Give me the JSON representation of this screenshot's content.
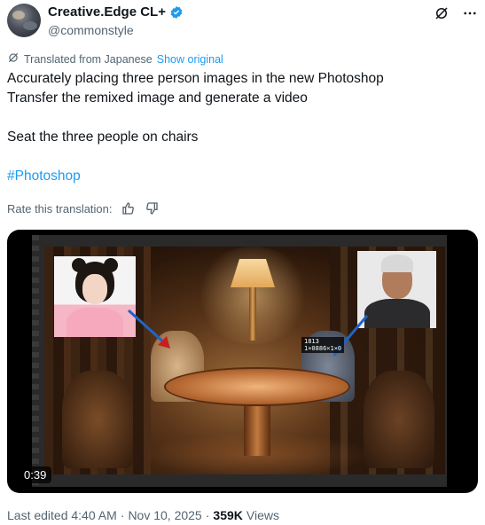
{
  "author": {
    "display_name": "Creative.Edge CL+",
    "handle": "@commonstyle",
    "verified_color": "#1d9bf0",
    "icons": [
      "grok-icon",
      "more-icon"
    ]
  },
  "translation": {
    "label": "Translated from Japanese",
    "show_original": "Show original"
  },
  "tweet": {
    "line1": "Accurately placing three person images in the new Photoshop",
    "line2": "Transfer the remixed image and generate a video",
    "line3": "Seat the three people on chairs",
    "hashtag": "#Photoshop"
  },
  "rate": {
    "label": "Rate this translation:"
  },
  "media": {
    "duration": "0:39",
    "tag_line1": "1813",
    "tag_line2": "1×0886×1×0"
  },
  "meta": {
    "edited": "Last edited 4:40 AM",
    "separator": "·",
    "date": "Nov 10, 2025",
    "separator2": "·",
    "views_count": "359K",
    "views_label": "Views"
  },
  "colors": {
    "link": "#1d9bf0",
    "muted": "#536471",
    "text": "#0f1419",
    "arrow": "#1e64c8"
  }
}
